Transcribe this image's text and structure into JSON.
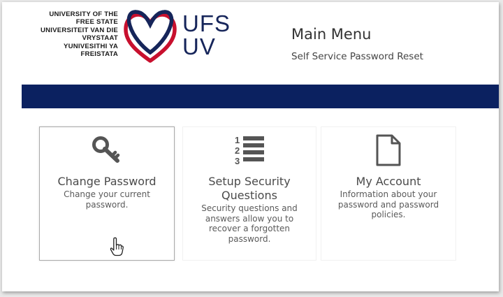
{
  "logo": {
    "lines": [
      "UNIVERSITY OF THE",
      "FREE STATE",
      "UNIVERSITEIT VAN DIE",
      "VRYSTAAT",
      "YUNIVESITHI YA",
      "FREISTATA"
    ],
    "wordmark_top": "UFS",
    "wordmark_bottom": "UV",
    "colors": {
      "navy": "#16255a",
      "red": "#c8102e"
    }
  },
  "header": {
    "title": "Main Menu",
    "subtitle": "Self Service Password Reset"
  },
  "banner": {
    "color": "#0b2160"
  },
  "tiles": [
    {
      "title": "Change Password",
      "description": "Change your current password.",
      "icon": "key-icon",
      "selected": true
    },
    {
      "title": "Setup Security Questions",
      "description": "Security questions and answers allow you to recover a forgotten password.",
      "icon": "numbered-list-icon",
      "selected": false
    },
    {
      "title": "My Account",
      "description": "Information about your password and password policies.",
      "icon": "document-icon",
      "selected": false
    }
  ],
  "cursor": {
    "icon": "hand-pointer-icon"
  }
}
